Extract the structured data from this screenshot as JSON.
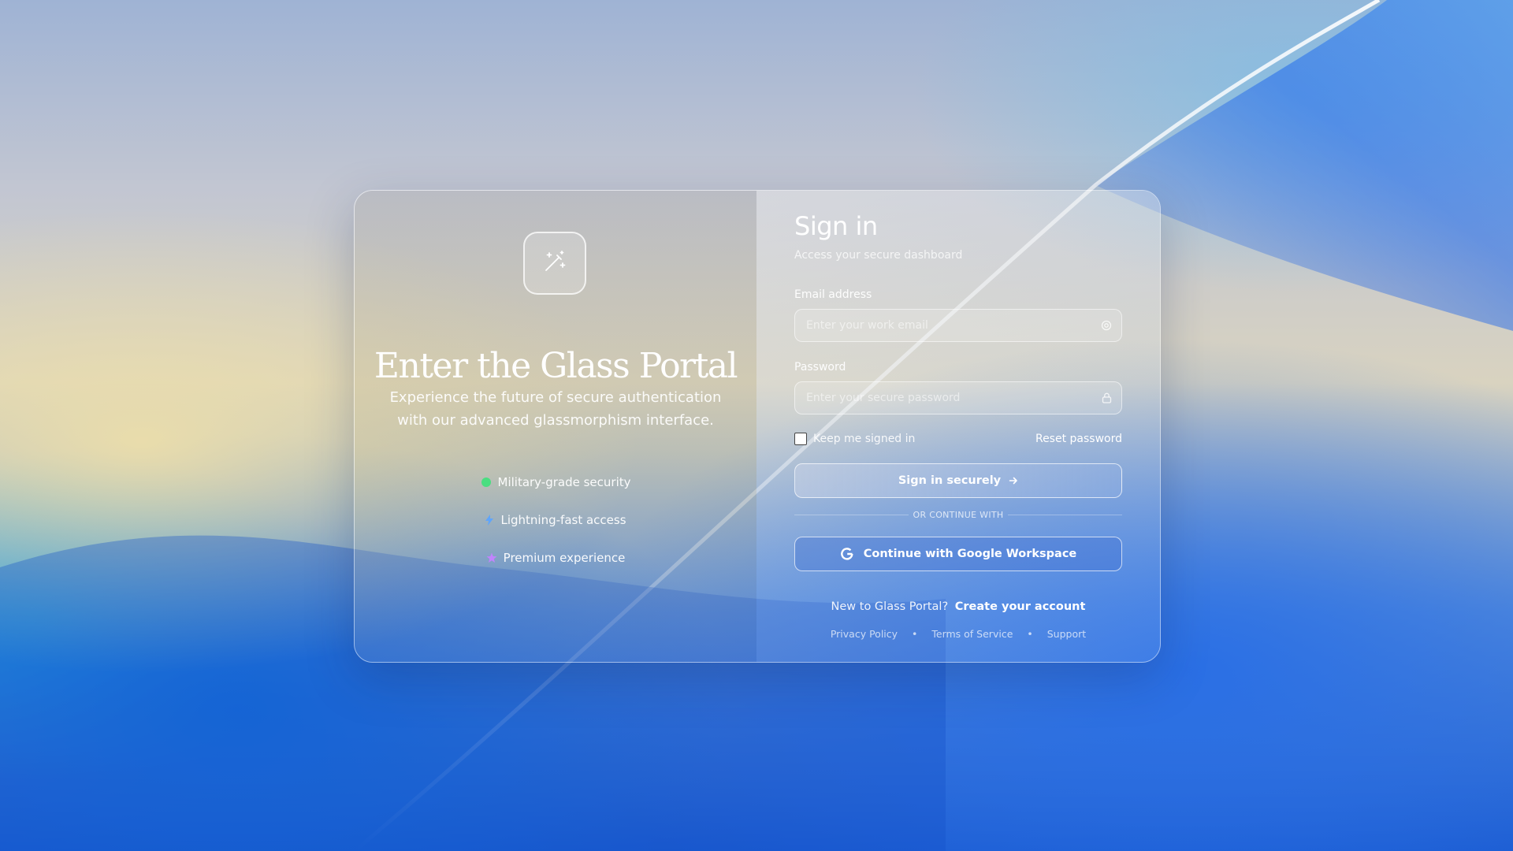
{
  "hero": {
    "title": "Enter the Glass Portal",
    "subtitle": "Experience the future of secure authentication with our advanced glassmorphism interface.",
    "features": [
      {
        "label": "Military-grade security",
        "color": "#4ade80"
      },
      {
        "label": "Lightning-fast access",
        "color": "#60a5fa"
      },
      {
        "label": "Premium experience",
        "color": "#c084fc"
      }
    ]
  },
  "form": {
    "heading": "Sign in",
    "subheading": "Access your secure dashboard",
    "email_label": "Email address",
    "email_placeholder": "Enter your work email",
    "password_label": "Password",
    "password_placeholder": "Enter your secure password",
    "remember_label": "Keep me signed in",
    "reset_label": "Reset password",
    "submit_label": "Sign in securely",
    "divider_label": "OR CONTINUE WITH",
    "google_label": "Continue with Google Workspace",
    "new_prompt": "New to Glass Portal?",
    "create_label": "Create your account"
  },
  "footer": {
    "privacy": "Privacy Policy",
    "terms": "Terms of Service",
    "support": "Support",
    "separator": "•"
  }
}
